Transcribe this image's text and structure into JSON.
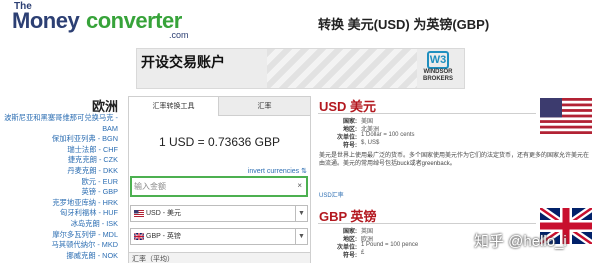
{
  "header": {
    "logo": {
      "the": "The",
      "money": "Money",
      "converter": "converter",
      "com": ".com"
    },
    "title": "转换 美元(USD) 为英镑(GBP)"
  },
  "banner": {
    "text": "开设交易账户",
    "logo_mark": "W3",
    "logo_line1": "WINDSOR",
    "logo_line2": "BROKERS"
  },
  "sidebar": {
    "heading": "欧洲",
    "items": [
      "波斯尼亚和黑塞哥维那可兑换马克 -",
      "BAM",
      "保加利亚列弗 - BGN",
      "瑞士法郎 - CHF",
      "捷克克朗 - CZK",
      "丹麦克朗 - DKK",
      "欧元 - EUR",
      "英镑 - GBP",
      "克罗地亚库纳 - HRK",
      "匈牙利福林 - HUF",
      "冰岛克朗 - ISK",
      "摩尔多瓦列伊 - MDL",
      "马其顿代纳尔 - MKD",
      "挪威克朗 - NOK"
    ]
  },
  "converter": {
    "tabs": [
      "汇率转换工具",
      "汇率"
    ],
    "rate_text": "1 USD = 0.73636 GBP",
    "invert_label": "invert currencies ⇅",
    "amount_placeholder": "输入金额",
    "clear_icon_glyph": "×",
    "from_label": "USD - 美元",
    "to_label": "GBP - 英镑",
    "arrow_glyph": "▼",
    "bottom_label": "汇率（平均）"
  },
  "currencies": [
    {
      "title": "USD 美元",
      "rows": [
        {
          "label": "国家:",
          "value": "美国"
        },
        {
          "label": "地区:",
          "value": "北美洲"
        },
        {
          "label": "次单位:",
          "value": "1 Dollar = 100 cents"
        },
        {
          "label": "符号:",
          "value": "$, US$"
        }
      ],
      "description": "美元是世界上使用最广泛的货币。多个国家使用美元作为它们的法定货币，还有更多的国家允许美元在由流通。美元的常用绰号包括buck或者greenback。",
      "link": "USD汇率",
      "flag": "us"
    },
    {
      "title": "GBP 英镑",
      "rows": [
        {
          "label": "国家:",
          "value": "英国"
        },
        {
          "label": "地区:",
          "value": "欧洲"
        },
        {
          "label": "次单位:",
          "value": "1 Pound = 100 pence"
        },
        {
          "label": "符号:",
          "value": "£"
        }
      ],
      "flag": "uk"
    }
  ],
  "watermark": "知乎 @hello_i",
  "colors": {
    "brand_navy": "#2c3f73",
    "brand_green": "#37a33a",
    "link_blue": "#2e6fb3",
    "currency_red": "#b3181f",
    "input_border_green": "#4cb050"
  }
}
